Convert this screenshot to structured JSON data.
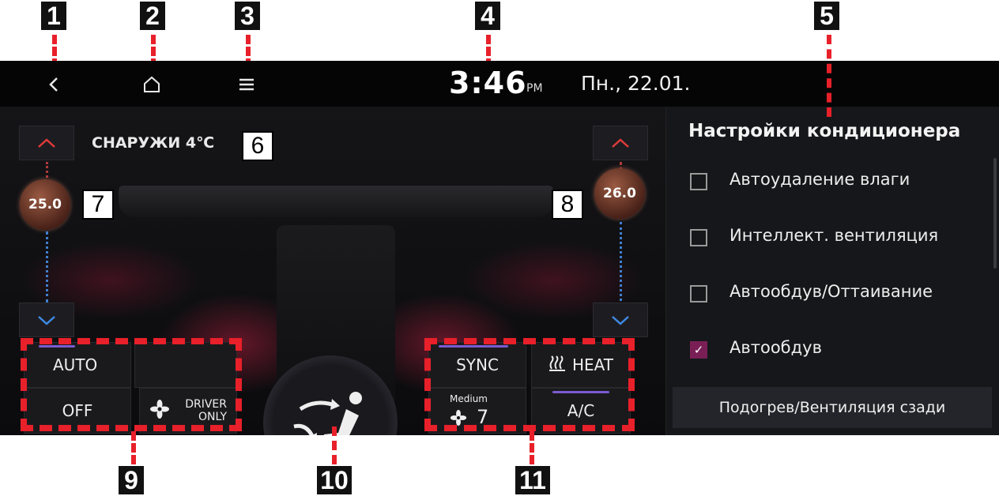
{
  "callouts": [
    "1",
    "2",
    "3",
    "4",
    "5",
    "6",
    "7",
    "8",
    "9",
    "10",
    "11"
  ],
  "topbar": {
    "back_icon": "back-chevron-icon",
    "home_icon": "home-icon",
    "menu_icon": "menu-icon",
    "time": "3:46",
    "ampm": "PM",
    "date": "Пн., 22.01."
  },
  "climate": {
    "outside_label": "СНАРУЖИ 4℃",
    "driver_temp": "25.0",
    "passenger_temp": "26.0",
    "buttons": {
      "auto": "AUTO",
      "off": "OFF",
      "driver_only": "DRIVER ONLY",
      "sync": "SYNC",
      "heat": "HEAT",
      "fan_level_label": "Medium",
      "fan_speed": "7",
      "ac": "A/C"
    },
    "colors": {
      "accent": "#7b5bd0",
      "callout_dash": "#e8202a"
    }
  },
  "panel": {
    "title": "Настройки кондиционера",
    "items": [
      {
        "label": "Автоудаление влаги",
        "checked": false
      },
      {
        "label": "Интеллект. вентиляция",
        "checked": false
      },
      {
        "label": "Автообдув/Оттаивание",
        "checked": false
      },
      {
        "label": "Автообдув",
        "checked": true
      }
    ],
    "rear_button": "Подогрев/Вентиляция сзади"
  }
}
